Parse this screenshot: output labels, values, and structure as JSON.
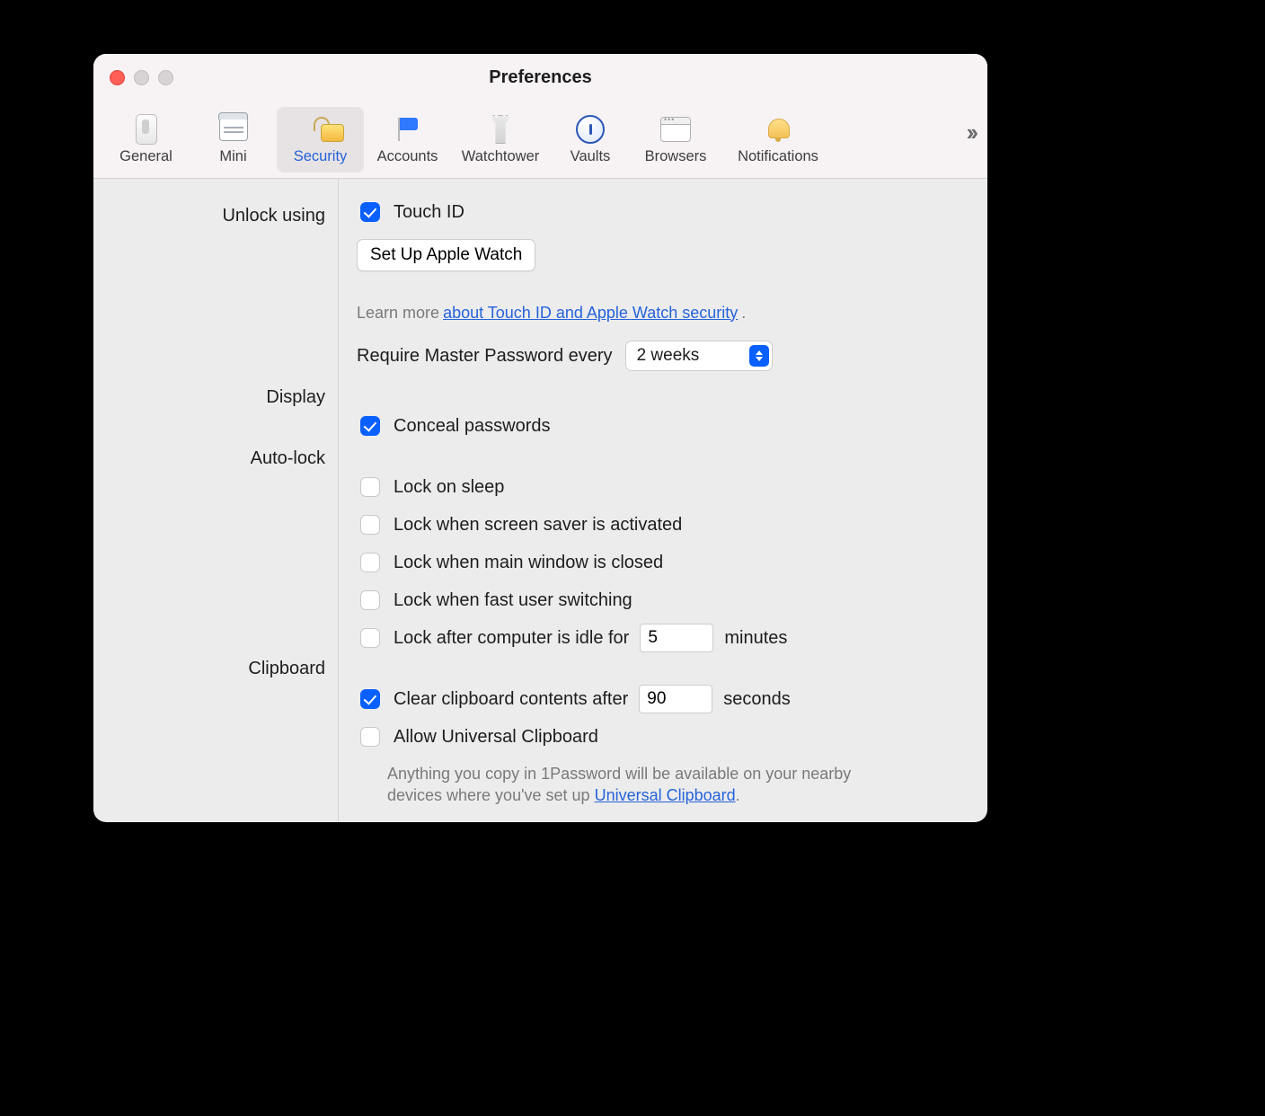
{
  "window": {
    "title": "Preferences"
  },
  "toolbar": {
    "tabs": [
      {
        "id": "general",
        "label": "General"
      },
      {
        "id": "mini",
        "label": "Mini"
      },
      {
        "id": "security",
        "label": "Security"
      },
      {
        "id": "accounts",
        "label": "Accounts"
      },
      {
        "id": "watchtower",
        "label": "Watchtower"
      },
      {
        "id": "vaults",
        "label": "Vaults"
      },
      {
        "id": "browsers",
        "label": "Browsers"
      },
      {
        "id": "notifications",
        "label": "Notifications"
      }
    ],
    "selected": "security",
    "overflow_glyph": "››"
  },
  "sections": {
    "unlock": {
      "label": "Unlock using"
    },
    "display": {
      "label": "Display"
    },
    "autolock": {
      "label": "Auto-lock"
    },
    "clipboard": {
      "label": "Clipboard"
    }
  },
  "unlock": {
    "touch_id": {
      "label": "Touch ID",
      "checked": true
    },
    "apple_watch_button": "Set Up Apple Watch",
    "learn_more_prefix": "Learn more ",
    "learn_more_link": "about Touch ID and Apple Watch security",
    "learn_more_suffix": ".",
    "require_label": "Require Master Password every",
    "require_value": "2 weeks"
  },
  "display": {
    "conceal": {
      "label": "Conceal passwords",
      "checked": true
    }
  },
  "autolock": {
    "sleep": {
      "label": "Lock on sleep",
      "checked": false
    },
    "screensaver": {
      "label": "Lock when screen saver is activated",
      "checked": false
    },
    "main_window": {
      "label": "Lock when main window is closed",
      "checked": false
    },
    "fast_switch": {
      "label": "Lock when fast user switching",
      "checked": false
    },
    "idle": {
      "label": "Lock after computer is idle for",
      "checked": false,
      "value": "5",
      "unit": "minutes"
    }
  },
  "clipboard": {
    "clear": {
      "label": "Clear clipboard contents after",
      "checked": true,
      "value": "90",
      "unit": "seconds"
    },
    "universal": {
      "label": "Allow Universal Clipboard",
      "checked": false
    },
    "desc_prefix": "Anything you copy in 1Password will be available on your nearby devices where you've set up ",
    "desc_link": "Universal Clipboard",
    "desc_suffix": "."
  }
}
